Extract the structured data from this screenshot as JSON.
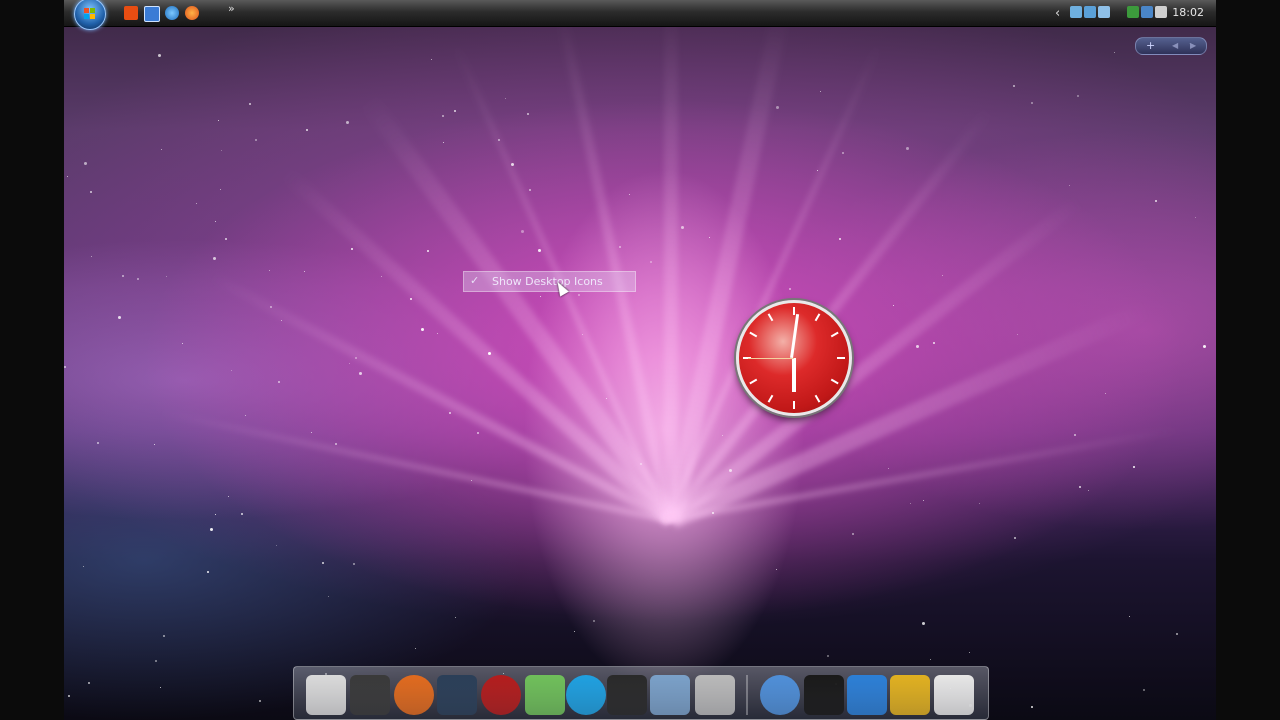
{
  "topbar": {
    "start_button": "windows-orb",
    "quicklaunch": [
      "media-player-icon",
      "show-desktop-icon",
      "internet-explorer-icon",
      "firefox-icon"
    ],
    "overflow_chevron": "»",
    "tray_chevron": "‹",
    "clock_time": "18:02"
  },
  "widget_controls": {
    "add": "+",
    "prev": "◀",
    "next": "▶"
  },
  "context_menu": {
    "items": [
      {
        "check": "✓",
        "label": "Show Desktop Icons",
        "checked": true
      }
    ]
  },
  "clock_gadget": {
    "hour": 6,
    "minute": 0,
    "second": 45,
    "face_color": "#d12222"
  },
  "dock": {
    "items": [
      "presentation-icon",
      "media-icon",
      "firefox-icon",
      "monitor-icon",
      "rocket-icon",
      "messenger-icon",
      "skype-icon",
      "audio-waveform-icon",
      "folder-icon",
      "tools-icon",
      "globe-icon",
      "shirt-icon",
      "help-icon",
      "utilities-icon",
      "recycle-bin-icon"
    ]
  }
}
